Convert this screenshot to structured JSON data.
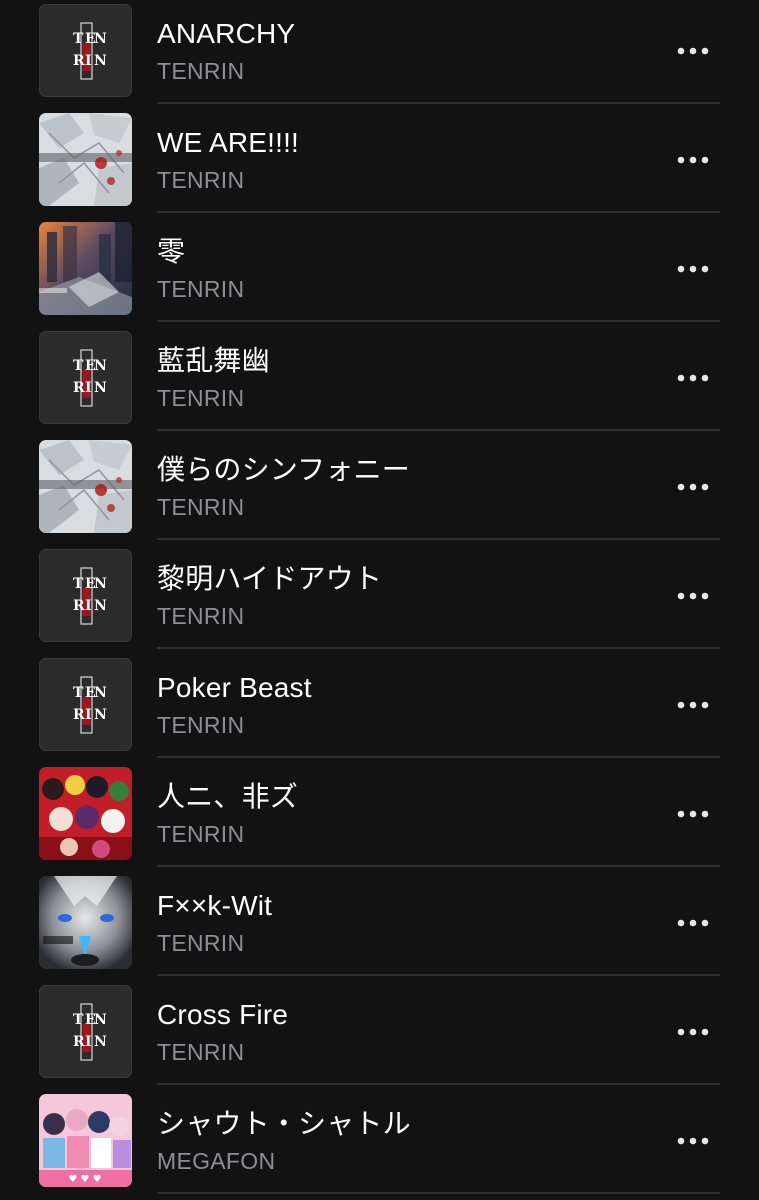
{
  "colors": {
    "background": "#121212",
    "title": "#ffffff",
    "subtitle": "#8e8e93",
    "divider": "#2e2e2e"
  },
  "logo_text": [
    "T",
    "E",
    "N",
    "R",
    "I",
    "N"
  ],
  "tracks": [
    {
      "title": "ANARCHY",
      "artist": "TENRIN",
      "art": "tenrin-logo"
    },
    {
      "title": "WE ARE!!!!",
      "artist": "TENRIN",
      "art": "shattered-white"
    },
    {
      "title": "零",
      "artist": "TENRIN",
      "art": "city-night"
    },
    {
      "title": "藍乱舞幽",
      "artist": "TENRIN",
      "art": "tenrin-logo"
    },
    {
      "title": "僕らのシンフォニー",
      "artist": "TENRIN",
      "art": "shattered-white"
    },
    {
      "title": "黎明ハイドアウト",
      "artist": "TENRIN",
      "art": "tenrin-logo"
    },
    {
      "title": "Poker Beast",
      "artist": "TENRIN",
      "art": "tenrin-logo"
    },
    {
      "title": "人ニ、非ズ",
      "artist": "TENRIN",
      "art": "group-red"
    },
    {
      "title": "F××k-Wit",
      "artist": "TENRIN",
      "art": "wolf-blue"
    },
    {
      "title": "Cross Fire",
      "artist": "TENRIN",
      "art": "tenrin-logo"
    },
    {
      "title": "シャウト・シャトル",
      "artist": "MEGAFON",
      "art": "group-pink"
    }
  ],
  "more_icon": "ellipsis-icon"
}
